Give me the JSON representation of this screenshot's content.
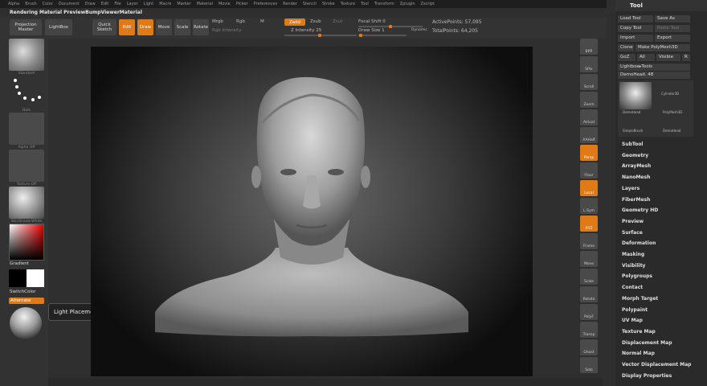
{
  "menu": [
    "Alpha",
    "Brush",
    "Color",
    "Document",
    "Draw",
    "Edit",
    "File",
    "Layer",
    "Light",
    "Macro",
    "Marker",
    "Material",
    "Movie",
    "Picker",
    "Preferences",
    "Render",
    "Stencil",
    "Stroke",
    "Texture",
    "Tool",
    "Transform",
    "Zplugin",
    "Zscript"
  ],
  "doc_title": "Rendering Material PreviewBumpViewerMaterial",
  "top": {
    "projection_master": "Projection Master",
    "lightbox": "LightBox",
    "quick_sketch": "Quick Sketch",
    "edit": "Edit",
    "draw": "Draw",
    "move": "Move",
    "scale": "Scale",
    "rotate": "Rotate",
    "mrgb": "Mrgb",
    "rgb": "Rgb",
    "m": "M",
    "rgb_intensity": "Rgb Intensity",
    "zadd": "Zadd",
    "zsub": "Zsub",
    "zcut": "Zcut",
    "focal_shift_label": "Focal Shift",
    "focal_shift_value": "0",
    "z_intensity_label": "Z Intensity",
    "z_intensity_value": "25",
    "draw_size_label": "Draw Size",
    "draw_size_value": "1",
    "dynamic": "Dynamic",
    "active_points_label": "ActivePoints:",
    "active_points_value": "57,095",
    "total_points_label": "TotalPoints:",
    "total_points_value": "64,205"
  },
  "left": {
    "standard": "Standard",
    "dots": "Dots",
    "alpha_off": "Alpha Off",
    "texture_off": "Texture Off",
    "material": "SkinShaderWhite",
    "gradient": "Gradient",
    "switch_color": "SwitchColor",
    "alternate": "Alternate"
  },
  "tooltip": "Light Placement",
  "right_tools": [
    "BPR",
    "SPix",
    "Scroll",
    "Zoom",
    "Actual",
    "AAHalf",
    "Persp",
    "Floor",
    "Local",
    "L.Sym",
    "XYZ",
    "Frame",
    "Move",
    "Scale",
    "Rotate",
    "PolyF",
    "Transp",
    "Ghost",
    "Solo"
  ],
  "tool_panel": {
    "title": "Tool",
    "load_tool": "Load Tool",
    "save_as": "Save As",
    "copy_tool": "Copy Tool",
    "paste_tool": "Paste Tool",
    "import": "Import",
    "export": "Export",
    "clone": "Clone",
    "make_polymesh": "Make PolyMesh3D",
    "goz": "GoZ",
    "all": "All",
    "visible": "Visible",
    "r": "R",
    "lightbox_tools": "Lightbox▸Tools",
    "current_tool": "DemoHead. 48",
    "thumb1": "DemoHead",
    "thumb2": "Cylinder3D",
    "thumb3": "PolyMesh3D",
    "thumb4": "SimpleBrush",
    "thumb5": "DemoHead",
    "sections": [
      "SubTool",
      "Geometry",
      "ArrayMesh",
      "NanoMesh",
      "Layers",
      "FiberMesh",
      "Geometry HD",
      "Preview",
      "Surface",
      "Deformation",
      "Masking",
      "Visibility",
      "Polygroups",
      "Contact",
      "Morph Target",
      "Polypaint",
      "UV Map",
      "Texture Map",
      "Displacement Map",
      "Normal Map",
      "Vector Displacement Map",
      "Display Properties"
    ]
  }
}
